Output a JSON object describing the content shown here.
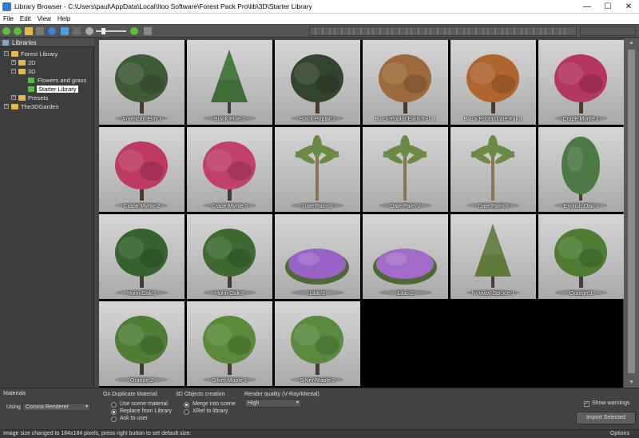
{
  "window": {
    "title": "Library Browser - C:\\Users\\paul\\AppData\\Local\\Itoo Software\\Forest Pack Pro\\lib\\3D\\Starter Library",
    "minimize": "—",
    "maximize": "☐",
    "close": "✕"
  },
  "menu": [
    "File",
    "Edit",
    "View",
    "Help"
  ],
  "sidebar": {
    "header": "Libraries",
    "tree": [
      {
        "label": "Forest Library",
        "expander": "−",
        "kind": "folder"
      },
      {
        "label": "2D",
        "expander": "+",
        "kind": "folder"
      },
      {
        "label": "3D",
        "expander": "−",
        "kind": "folder"
      },
      {
        "label": "Flowers and grass",
        "expander": "",
        "kind": "leaf"
      },
      {
        "label": "Starter Library",
        "expander": "",
        "kind": "leaf",
        "selected": true
      },
      {
        "label": "Presets",
        "expander": "+",
        "kind": "folder"
      },
      {
        "label": "The3DGarden",
        "expander": "+",
        "kind": "folder"
      }
    ]
  },
  "items": [
    {
      "name": "American Elm 1",
      "shape": "round",
      "color": "#3f5a37"
    },
    {
      "name": "Black Pine 1",
      "shape": "conifer",
      "color": "#3c6e35"
    },
    {
      "name": "Black Poplar 1",
      "shape": "round",
      "color": "#34452e"
    },
    {
      "name": "Black Poplar Early Fall 1",
      "shape": "round",
      "color": "#9c6a3c"
    },
    {
      "name": "Black Poplar Late Fall 1",
      "shape": "round",
      "color": "#b0652f"
    },
    {
      "name": "Crape Myrtle 1",
      "shape": "round",
      "color": "#b5365e"
    },
    {
      "name": "Crape Myrtle 2",
      "shape": "round",
      "color": "#be3a63"
    },
    {
      "name": "Crape Myrtle 3",
      "shape": "round",
      "color": "#c0416a"
    },
    {
      "name": "Date Palm 1",
      "shape": "palm",
      "color": "#6a8a45"
    },
    {
      "name": "Date Palm 2",
      "shape": "palm",
      "color": "#6a8a45"
    },
    {
      "name": "Date Palm 3",
      "shape": "palm",
      "color": "#6a8a45"
    },
    {
      "name": "English Oak 1",
      "shape": "tall",
      "color": "#4c7a44"
    },
    {
      "name": "Holm Oak 1",
      "shape": "round",
      "color": "#35632d"
    },
    {
      "name": "Holm Oak 2",
      "shape": "round",
      "color": "#3e6a32"
    },
    {
      "name": "Lilac 1",
      "shape": "bush",
      "color": "#9a62c6"
    },
    {
      "name": "Lilac 2",
      "shape": "bush",
      "color": "#a26bc9"
    },
    {
      "name": "Norway Spruce 1",
      "shape": "conifer",
      "color": "#5f7a3a"
    },
    {
      "name": "Orange 1",
      "shape": "round",
      "color": "#4d7c32"
    },
    {
      "name": "Orange 2",
      "shape": "round",
      "color": "#4f7d36"
    },
    {
      "name": "Silver Maple 1",
      "shape": "round",
      "color": "#5a8a3a"
    },
    {
      "name": "Silver Maple 2",
      "shape": "round",
      "color": "#5a8a40"
    }
  ],
  "bottom": {
    "materials_label": "Materials",
    "using_label": "Using",
    "renderer": "Corona Renderer",
    "dup_label": "On Duplicate Material:",
    "dup_options": [
      "Use scene material",
      "Replace from Library",
      "Ask to user"
    ],
    "dup_selected": 1,
    "creation_label": "3D Objects creation",
    "creation_options": [
      "Merge into scene",
      "XRef to library"
    ],
    "creation_selected": 0,
    "quality_label": "Render quality (V-Ray/Mental)",
    "quality_value": "High",
    "show_warnings": "Show warnings",
    "show_warnings_checked": true,
    "import_button": "Import Selected",
    "dropdown_arrow": "▾",
    "check_mark": "✓"
  },
  "status": {
    "message": "Image size changed to 184x184 pixels, press right button to set default size.",
    "options": "Options"
  }
}
